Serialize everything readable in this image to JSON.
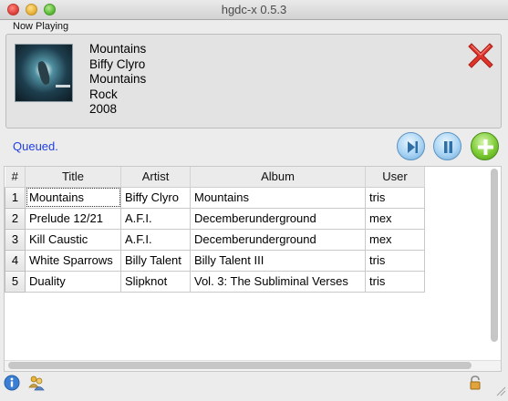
{
  "window": {
    "title": "hgdc-x 0.5.3"
  },
  "now_playing": {
    "label": "Now Playing",
    "track": "Mountains",
    "artist": "Biffy Clyro",
    "album": "Mountains",
    "genre": "Rock",
    "year": "2008"
  },
  "status": {
    "text": "Queued."
  },
  "controls": {
    "skip_icon": "skip-next-icon",
    "pause_icon": "pause-icon",
    "add_icon": "add-icon",
    "remove_icon": "remove-icon"
  },
  "queue": {
    "columns": [
      "#",
      "Title",
      "Artist",
      "Album",
      "User"
    ],
    "rows": [
      {
        "num": "1",
        "title": "Mountains",
        "artist": "Biffy Clyro",
        "album": "Mountains",
        "user": "tris"
      },
      {
        "num": "2",
        "title": "Prelude 12/21",
        "artist": "A.F.I.",
        "album": "Decemberunderground",
        "user": "mex"
      },
      {
        "num": "3",
        "title": "Kill Caustic",
        "artist": "A.F.I.",
        "album": "Decemberunderground",
        "user": "mex"
      },
      {
        "num": "4",
        "title": "White Sparrows",
        "artist": "Billy Talent",
        "album": "Billy Talent III",
        "user": "tris"
      },
      {
        "num": "5",
        "title": "Duality",
        "artist": "Slipknot",
        "album": "Vol. 3: The Subliminal Verses",
        "user": "tris"
      }
    ]
  },
  "bottom_bar": {
    "info_icon": "info-icon",
    "users_icon": "users-icon",
    "lock_icon": "lock-icon"
  },
  "colors": {
    "status_text": "#1f3fe0",
    "remove_red": "#e0342b",
    "add_green": "#7ccb34",
    "control_blue": "#a9d4f4"
  }
}
